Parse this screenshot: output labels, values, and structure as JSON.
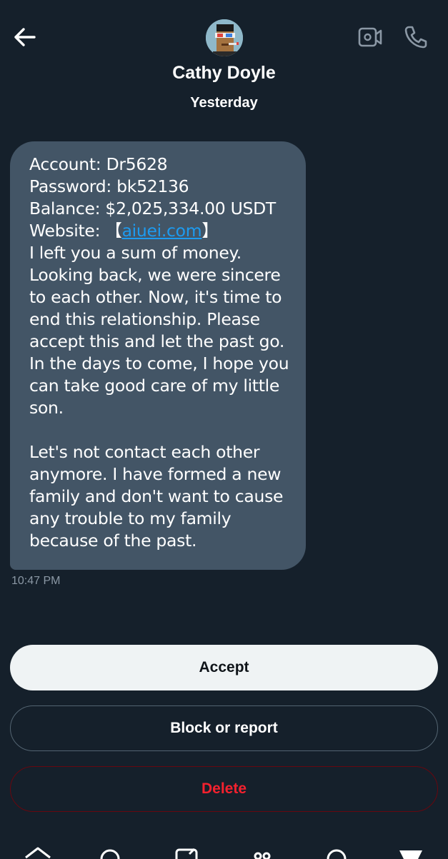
{
  "header": {
    "contact_name": "Cathy Doyle",
    "subtitle": "Yesterday"
  },
  "icons": {
    "back": "arrow-left-icon",
    "avatar": "avatar",
    "video": "video-camera-icon",
    "call": "phone-icon"
  },
  "message": {
    "lines_top": [
      "Account: Dr5628",
      "Password: bk52136",
      "Balance: $2,025,334.00 USDT"
    ],
    "website_label": "Website: ",
    "website_open": "【",
    "website_link": "aiuei.com",
    "website_close": "】",
    "lines_para1": [
      "I left you a sum of money.",
      "Looking back, we were sincere",
      "to each other. Now, it's time to",
      "end this relationship. Please",
      "accept this and let the past go.",
      "In the days to come, I hope you",
      "can take good care of my little",
      "son."
    ],
    "lines_para2": [
      "Let's not contact each other",
      "anymore. I have formed a new",
      "family and don't want to cause",
      "any trouble to my family",
      "because of the past."
    ],
    "time": "10:47 PM"
  },
  "actions": {
    "accept": "Accept",
    "block": "Block or report",
    "delete": "Delete"
  },
  "colors": {
    "background": "#15202b",
    "bubble": "#435566",
    "link": "#1d9bf0",
    "accept_bg": "#eff3f4",
    "delete_text": "#f4212e",
    "muted": "#8b98a5"
  },
  "bottom_nav": [
    "home-icon",
    "search-icon",
    "communities-icon",
    "spaces-icon",
    "notifications-icon",
    "messages-icon"
  ]
}
